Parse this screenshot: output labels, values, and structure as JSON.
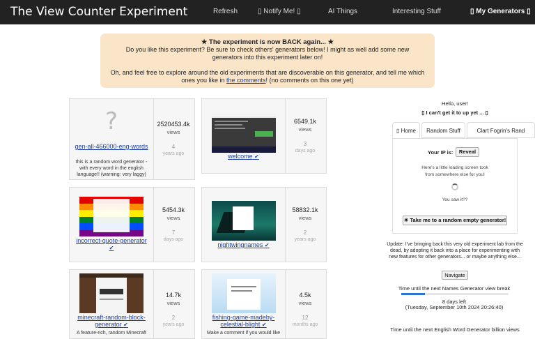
{
  "navbar": {
    "brand": "The View Counter Experiment",
    "links": [
      "Refresh",
      "▯ Notify Me! ▯",
      "AI Things",
      "Interesting Stuff",
      "▯ My Generators ▯"
    ]
  },
  "alert": {
    "headline": "★ The experiment is now BACK again... ★",
    "line1": "Do you like this experiment? Be sure to check others' generators below! I might as well add some new generators into this experiment later on!",
    "line2_pre": "Oh, and feel free to explore around the old experiments that are discoverable on this generator, and tell me which ones you like in ",
    "line2_link": "the comments",
    "line2_post": "! (no comments on this one yet)"
  },
  "cards": [
    {
      "name": "gen-all-466000-eng-words",
      "verified": false,
      "desc": "this is a random word generator - with every word in the english language!! (warning: very laggy)",
      "count": "2520453.4k",
      "views": "views",
      "age_num": "4",
      "age_unit": "years ago"
    },
    {
      "name": "welcome",
      "verified": true,
      "desc": "",
      "count": "6549.1k",
      "views": "views",
      "age_num": "3",
      "age_unit": "days ago"
    },
    {
      "name": "incorrect-quote-generator",
      "verified": true,
      "desc": "",
      "count": "5454.3k",
      "views": "views",
      "age_num": "7",
      "age_unit": "days ago"
    },
    {
      "name": "nightwingnames",
      "verified": true,
      "desc": "",
      "count": "58832.1k",
      "views": "views",
      "age_num": "2",
      "age_unit": "years ago"
    },
    {
      "name": "minecraft-random-block-generator",
      "verified": true,
      "desc": "A feature-rich, random Minecraft",
      "count": "14.7k",
      "views": "views",
      "age_num": "2",
      "age_unit": "years ago"
    },
    {
      "name": "fishing-game-madeby-celestial-blight",
      "verified": true,
      "desc": "Make a comment if you would like",
      "count": "4.5k",
      "views": "views",
      "age_num": "12",
      "age_unit": "months ago"
    }
  ],
  "check_glyph": "✔",
  "placeholder_glyph": "?",
  "sidebar": {
    "hello": "Hello, user!",
    "subtitle": "▯ I can't get it to up yet ... ▯",
    "tabs": [
      "▯ Home",
      "Random Stuff",
      "Clart Fogrin's Rand"
    ],
    "ip_label": "Your IP is:",
    "reveal": "Reveal",
    "loading1": "Here's a little loading screen took",
    "loading2": "from somewhere else for you!",
    "saw": "You saw it??",
    "random_btn": "☀ Take me to a random empty generator!",
    "update": "Update: I've bringing back this very old experiment lab from the dead, by adopting it back into a place for experimenting with new features for other generators... or maybe anything else...",
    "navigate": "Navigate",
    "timer1_label": "Time until the next Names Generator view break",
    "timer1_left": "8 days left",
    "timer1_date": "(Tuesday, September 10th 2024 20:26:40)",
    "timer1_progress": 0.22,
    "timer2_label": "Time until the next English Word Generator billion views"
  },
  "colors": {
    "navbar": "#222222",
    "alert": "#fbe5c8",
    "link": "#1b3fa6",
    "progress": "#2a74d6"
  }
}
